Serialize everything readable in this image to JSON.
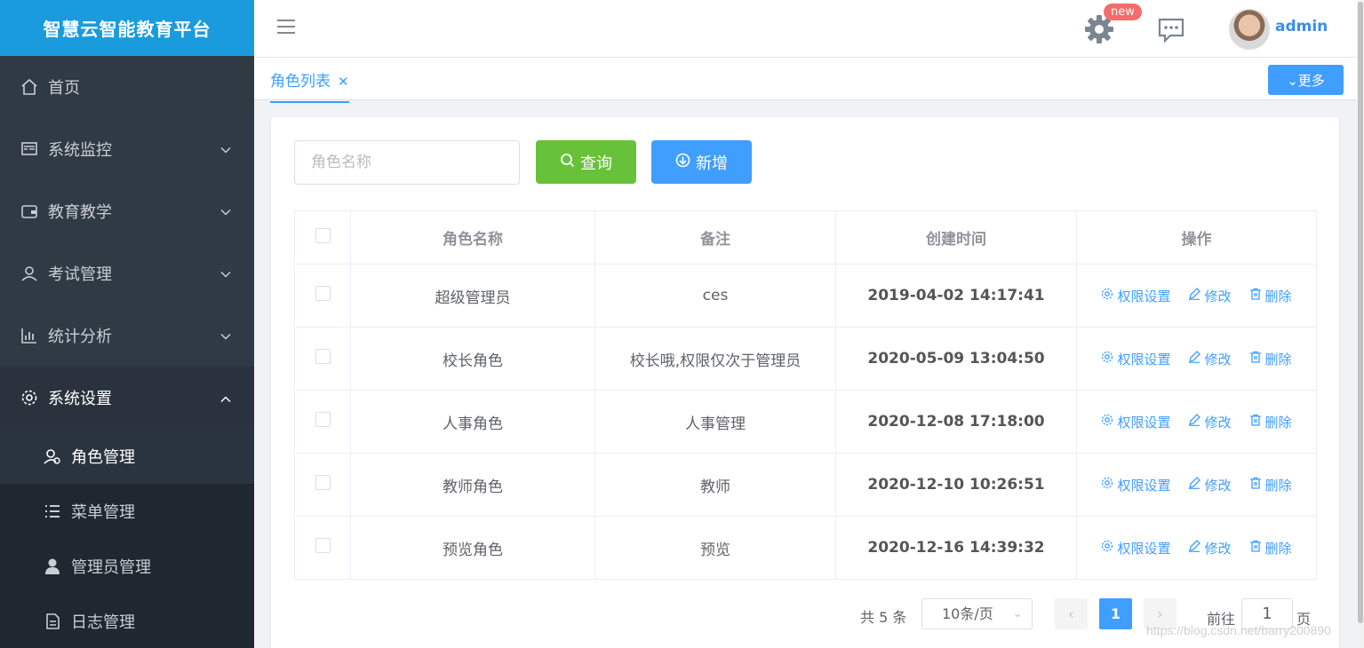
{
  "brand": {
    "title": "智慧云智能教育平台"
  },
  "sidebar": {
    "items": [
      {
        "label": "首页",
        "icon": "home-icon"
      },
      {
        "label": "系统监控",
        "icon": "monitor-icon"
      },
      {
        "label": "教育教学",
        "icon": "wallet-icon"
      },
      {
        "label": "考试管理",
        "icon": "exam-icon"
      },
      {
        "label": "统计分析",
        "icon": "chart-icon"
      },
      {
        "label": "系统设置",
        "icon": "gear-icon"
      }
    ],
    "submenu": [
      {
        "label": "角色管理",
        "icon": "role-icon"
      },
      {
        "label": "菜单管理",
        "icon": "list-icon"
      },
      {
        "label": "管理员管理",
        "icon": "user-icon"
      },
      {
        "label": "日志管理",
        "icon": "log-icon"
      }
    ]
  },
  "header": {
    "new_badge": "new",
    "username": "admin"
  },
  "tabs": {
    "active_label": "角色列表",
    "more_label": "更多"
  },
  "search": {
    "placeholder": "角色名称",
    "query_label": "查询",
    "add_label": "新增"
  },
  "table": {
    "columns": [
      "角色名称",
      "备注",
      "创建时间",
      "操作"
    ],
    "rows": [
      {
        "name": "超级管理员",
        "note": "ces",
        "time": "2019-04-02 14:17:41"
      },
      {
        "name": "校长角色",
        "note": "校长哦,权限仅次于管理员",
        "time": "2020-05-09 13:04:50"
      },
      {
        "name": "人事角色",
        "note": "人事管理",
        "time": "2020-12-08 17:18:00"
      },
      {
        "name": "教师角色",
        "note": "教师",
        "time": "2020-12-10 10:26:51"
      },
      {
        "name": "预览角色",
        "note": "预览",
        "time": "2020-12-16 14:39:32"
      }
    ],
    "actions": {
      "perm": "权限设置",
      "edit": "修改",
      "delete": "删除"
    }
  },
  "pagination": {
    "total_label": "共 5 条",
    "page_size": "10条/页",
    "current_page": "1",
    "goto_label": "前往",
    "goto_value": "1",
    "goto_suffix": "页"
  },
  "watermark": "https://blog.csdn.net/barry200890",
  "colors": {
    "primary": "#409eff",
    "success": "#67c23a",
    "brand_bg": "#1a9bdd",
    "sidebar_bg": "#2f3a45"
  }
}
